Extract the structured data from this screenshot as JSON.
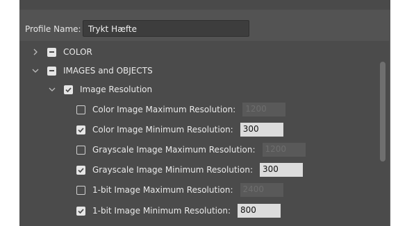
{
  "profile": {
    "label": "Profile Name:",
    "value": "Trykt Hæfte"
  },
  "tree": {
    "color_group": {
      "label": "COLOR"
    },
    "images_group": {
      "label": "IMAGES and OBJECTS"
    },
    "image_resolution": {
      "label": "Image Resolution"
    },
    "items": [
      {
        "label": "Color Image Maximum Resolution:",
        "checked": false,
        "value": "1200"
      },
      {
        "label": "Color Image Minimum Resolution:",
        "checked": true,
        "value": "300"
      },
      {
        "label": "Grayscale Image Maximum Resolution:",
        "checked": false,
        "value": "1200"
      },
      {
        "label": "Grayscale Image Minimum Resolution:",
        "checked": true,
        "value": "300"
      },
      {
        "label": "1-bit Image Maximum Resolution:",
        "checked": false,
        "value": "2400"
      },
      {
        "label": "1-bit Image Minimum Resolution:",
        "checked": true,
        "value": "800"
      }
    ]
  },
  "colors": {
    "panel": "#535353",
    "tree_bg": "#4b4b4b",
    "text": "#e6e6e6",
    "input_enabled": "#dcdcdc",
    "input_disabled": "#595959"
  }
}
